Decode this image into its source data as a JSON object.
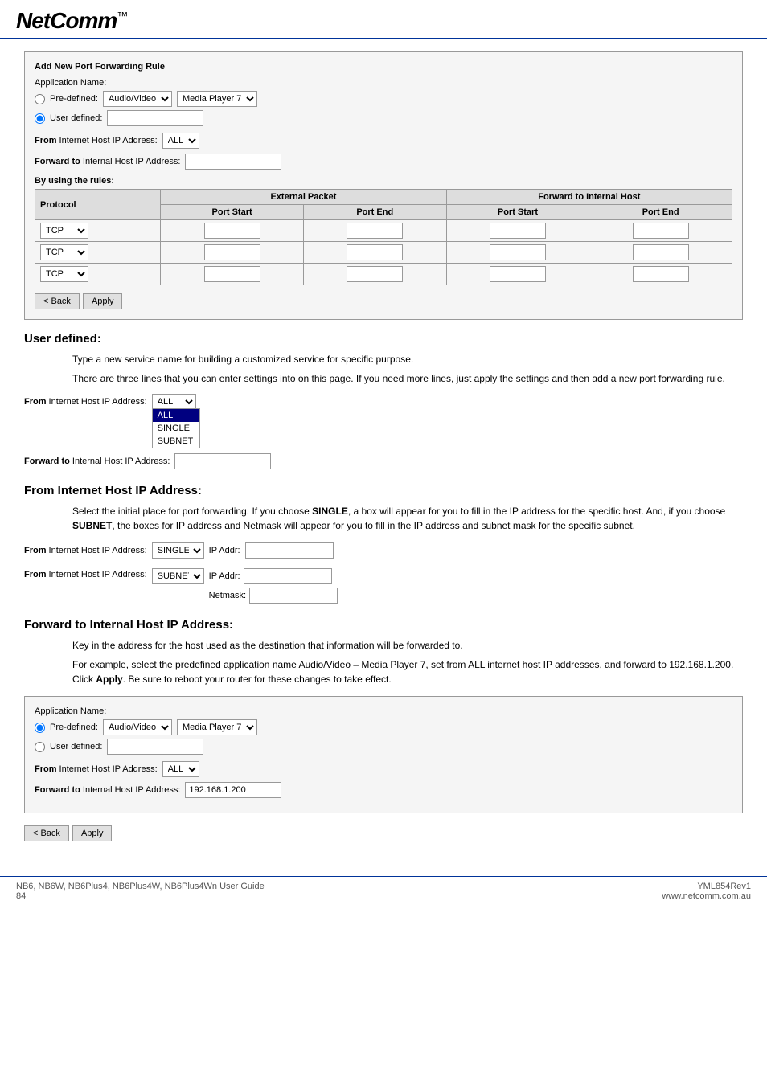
{
  "header": {
    "logo_text": "NetComm",
    "logo_tm": "™",
    "border_color": "#003399"
  },
  "form_top": {
    "title": "Add New Port Forwarding Rule",
    "app_name_label": "Application Name:",
    "predefined_label": "Pre-defined:",
    "user_defined_label": "User defined:",
    "predefined_cat_value": "Audio/Video",
    "predefined_sub_value": "Media Player 7",
    "from_label": "From Internet Host IP Address:",
    "from_value": "ALL",
    "forward_label": "Forward to Internal Host IP Address:",
    "by_rules_label": "By using the rules:",
    "table_headers": {
      "protocol": "Protocol",
      "external_packet": "External Packet",
      "forward_to_internal": "Forward to Internal Host",
      "port_start": "Port Start",
      "port_end": "Port End"
    },
    "table_rows": [
      {
        "protocol": "TCP"
      },
      {
        "protocol": "TCP"
      },
      {
        "protocol": "TCP"
      }
    ],
    "back_btn": "< Back",
    "apply_btn": "Apply"
  },
  "section_user_defined": {
    "heading": "User defined:",
    "para1": "Type a new service name for building a customized service for specific purpose.",
    "para2": "There are three lines that you can enter settings into on this page. If you need more lines, just apply the settings and then add a new port forwarding rule.",
    "from_label": "From Internet Host IP Address:",
    "from_value": "ALL",
    "forward_label": "Forward to Internal Host IP Address:",
    "dropdown_options": [
      "ALL",
      "SINGLE",
      "SUBNET"
    ],
    "dropdown_selected": "ALL"
  },
  "section_from_ip": {
    "heading": "From Internet Host IP Address:",
    "para1": "Select the initial place for port forwarding. If you choose SINGLE, a box will appear for you to fill in the IP address for the specific host. And, if you choose SUBNET, the boxes for IP address and Netmask will appear for you to fill in the IP address and subnet mask for the specific subnet.",
    "single_label": "From Internet Host IP Address:",
    "single_value": "SINGLE",
    "single_ipaddr_label": "IP Addr:",
    "subnet_label": "From Internet Host IP Address:",
    "subnet_value": "SUBNET",
    "subnet_ipaddr_label": "IP Addr:",
    "subnet_netmask_label": "Netmask:"
  },
  "section_forward_to": {
    "heading": "Forward to Internal Host IP Address:",
    "para1": "Key in the address for the host used as the destination that information will be forwarded to.",
    "para2": "For example, select the predefined application name Audio/Video – Media Player 7, set from ALL internet host IP addresses, and forward to 192.168.1.200. Click Apply. Be sure to reboot your router for these changes to take effect.",
    "apply_word": "Apply",
    "form": {
      "title": "Application Name:",
      "predefined_label": "Pre-defined:",
      "user_defined_label": "User defined:",
      "predefined_cat": "Audio/Video",
      "predefined_sub": "Media Player 7",
      "from_label": "From Internet Host IP Address:",
      "from_value": "ALL",
      "forward_label": "Forward to Internal Host IP Address:",
      "forward_ip": "192.168.1.200"
    },
    "back_btn": "< Back",
    "apply_btn": "Apply"
  },
  "footer": {
    "left": "NB6, NB6W, NB6Plus4, NB6Plus4W, NB6Plus4Wn User Guide\n84",
    "right": "YML854Rev1\nwww.netcomm.com.au"
  }
}
